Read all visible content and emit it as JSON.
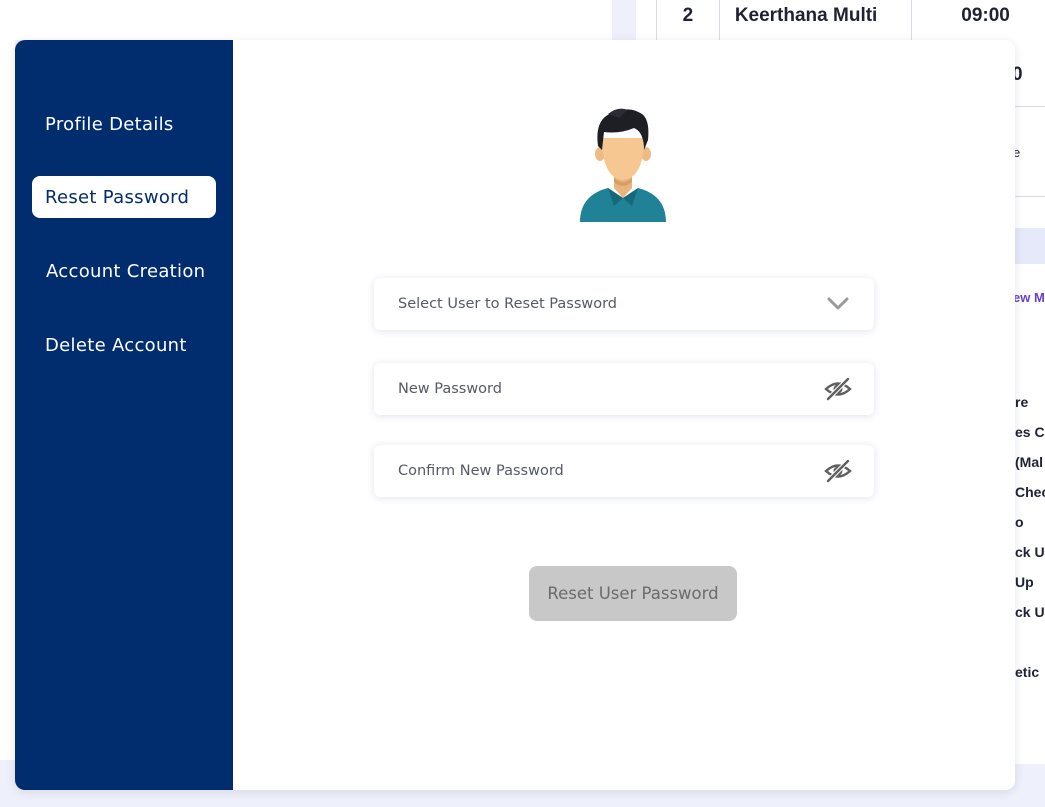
{
  "background": {
    "table_row": {
      "index": "2",
      "name": "Keerthana Multi",
      "time": "09:00"
    },
    "fragments": [
      "0",
      "e",
      "ew M",
      "re",
      "es Ca",
      "(Mal",
      "Chec",
      "o",
      "ck Up",
      "Up",
      "ck Up",
      "etic"
    ]
  },
  "sidebar": {
    "items": [
      {
        "label": "Profile Details",
        "active": false
      },
      {
        "label": "Reset Password",
        "active": true
      },
      {
        "label": "Account Creation",
        "active": false
      },
      {
        "label": "Delete Account",
        "active": false
      }
    ]
  },
  "form": {
    "avatar_icon": "user-avatar-icon",
    "select_user": {
      "label": "Select User to Reset Password",
      "icon": "chevron-down-icon"
    },
    "new_password": {
      "placeholder": "New Password",
      "icon": "eye-off-icon"
    },
    "confirm_password": {
      "placeholder": "Confirm New Password",
      "icon": "eye-off-icon"
    },
    "submit_label": "Reset User Password"
  },
  "colors": {
    "sidebar_bg": "#012d6e",
    "page_bg": "#eef0fb",
    "button_disabled_bg": "#c8c8c8",
    "avatar_shirt": "#1f8296"
  }
}
